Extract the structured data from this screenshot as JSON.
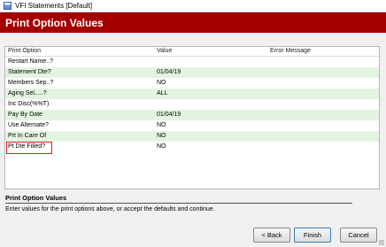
{
  "window": {
    "title": "VFI Statements [Default]"
  },
  "header": {
    "title": "Print Option Values"
  },
  "grid": {
    "columns": [
      "Print Option",
      "Value",
      "Error Message"
    ],
    "rows": [
      {
        "name": "Restart Name..?",
        "value": "",
        "alt": false
      },
      {
        "name": "Statement Dte?",
        "value": "01/04/19",
        "alt": true
      },
      {
        "name": "Members Sep..?",
        "value": "NO",
        "alt": false
      },
      {
        "name": "Aging Sel.....?",
        "value": "ALL",
        "alt": true
      },
      {
        "name": "Inc Disc(%%T)",
        "value": "",
        "alt": false
      },
      {
        "name": "Pay By Date",
        "value": "01/04/19",
        "alt": true
      },
      {
        "name": "Use Alternate?",
        "value": "NO",
        "alt": false
      },
      {
        "name": "Prt In Care Of",
        "value": "NO",
        "alt": true
      },
      {
        "name": "Pt Dte Filled?",
        "value": "NO",
        "alt": false,
        "highlighted": true
      }
    ]
  },
  "section": {
    "title": "Print Option Values",
    "description": "Enter values for the print options above, or accept the defaults and continue."
  },
  "buttons": {
    "back": "< Back",
    "finish": "Finish",
    "cancel": "Cancel"
  },
  "colors": {
    "header": "#a50000",
    "row_alt": "#e3f5e0",
    "highlight": "#e02020"
  }
}
